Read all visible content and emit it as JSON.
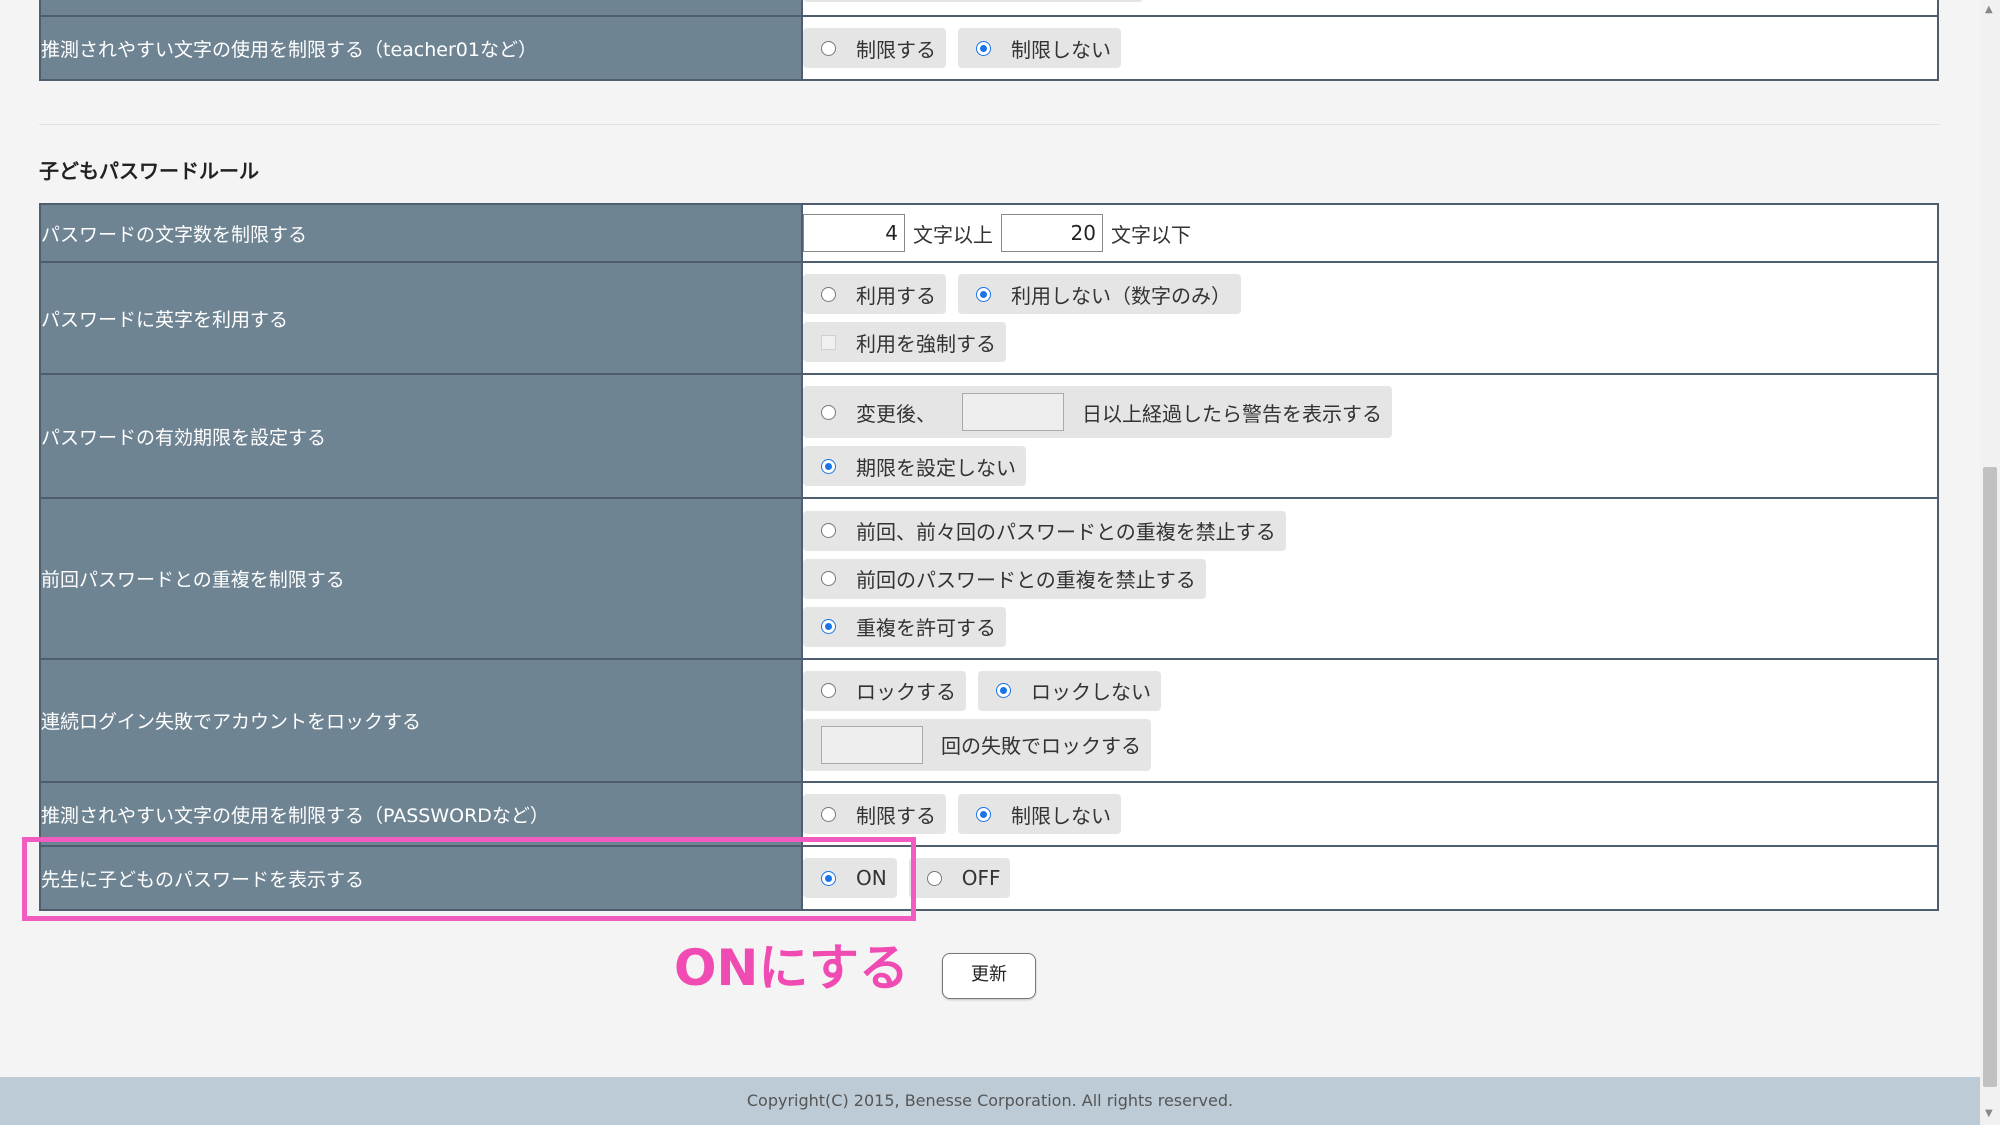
{
  "teacher_partial": {
    "guessable_label": "推測されやすい文字の使用を制限する（teacher01など）",
    "opt_restrict": "制限する",
    "opt_no_restrict": "制限しない"
  },
  "section_title": "子どもパスワードルール",
  "rows": {
    "length": {
      "label": "パスワードの文字数を制限する",
      "min": "4",
      "min_suffix": "文字以上",
      "max": "20",
      "max_suffix": "文字以下"
    },
    "alpha": {
      "label": "パスワードに英字を利用する",
      "opt_use": "利用する",
      "opt_not_use": "利用しない（数字のみ）",
      "opt_force": "利用を強制する"
    },
    "expiry": {
      "label": "パスワードの有効期限を設定する",
      "opt_after_prefix": "変更後、",
      "days_value": "",
      "opt_after_suffix": "日以上経過したら警告を表示する",
      "opt_no_expiry": "期限を設定しない"
    },
    "duplicate": {
      "label": "前回パスワードとの重複を制限する",
      "opt_prev_two": "前回、前々回のパスワードとの重複を禁止する",
      "opt_prev": "前回のパスワードとの重複を禁止する",
      "opt_allow": "重複を許可する"
    },
    "lock": {
      "label": "連続ログイン失敗でアカウントをロックする",
      "opt_lock": "ロックする",
      "opt_no_lock": "ロックしない",
      "count_value": "",
      "count_suffix": "回の失敗でロックする"
    },
    "guessable": {
      "label": "推測されやすい文字の使用を制限する（PASSWORDなど）",
      "opt_restrict": "制限する",
      "opt_no_restrict": "制限しない"
    },
    "show_teacher": {
      "label": "先生に子どものパスワードを表示する",
      "opt_on": "ON",
      "opt_off": "OFF"
    }
  },
  "annotation": "ONにする",
  "update_button": "更新",
  "footer": "Copyright(C) 2015, Benesse Corporation. All rights reserved.",
  "colors": {
    "label_bg": "#6f8493",
    "highlight": "#f25bc0",
    "annotation": "#ef4bb2",
    "radio_selected": "#1a73e8"
  }
}
